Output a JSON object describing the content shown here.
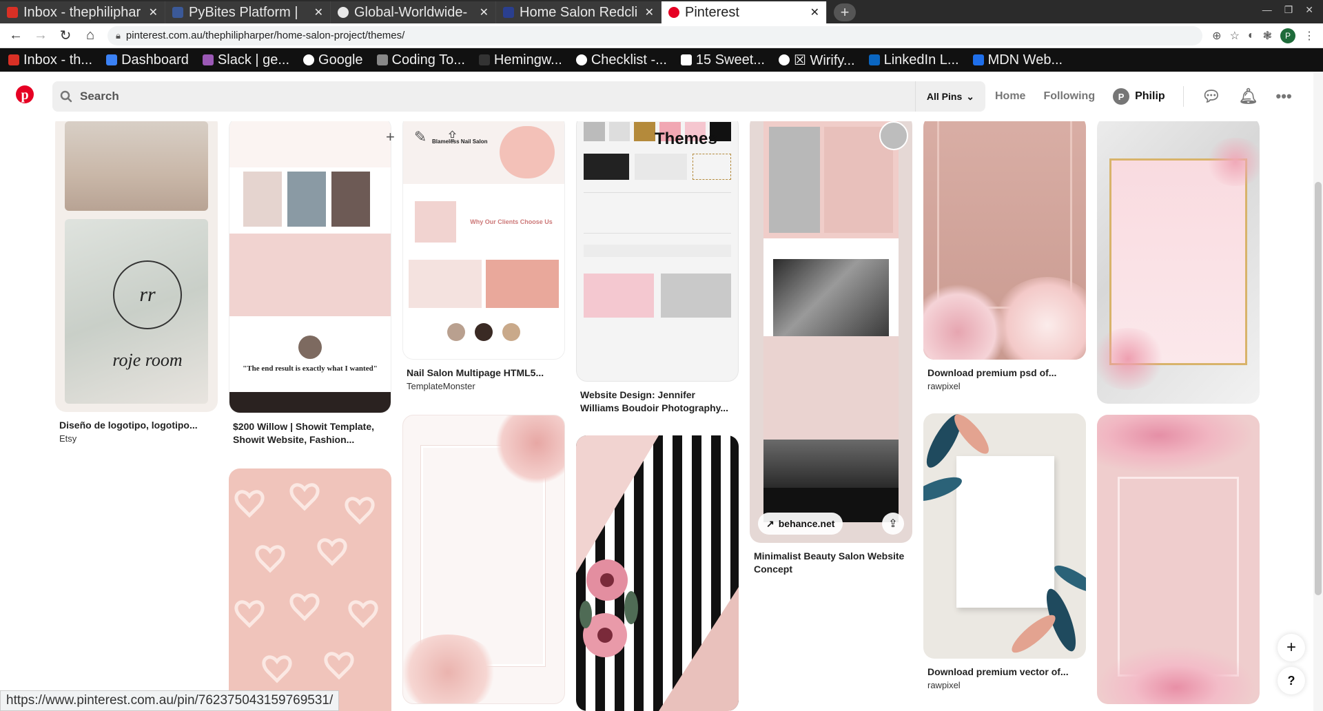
{
  "browser": {
    "tabs": [
      {
        "title": "Inbox - thephiliphar",
        "favicon_color": "#d93025",
        "active": false
      },
      {
        "title": "PyBites Platform | ",
        "favicon_color": "#3b5998",
        "active": false
      },
      {
        "title": "Global-Worldwide-",
        "favicon_color": "#e8e8e8",
        "active": false
      },
      {
        "title": "Home Salon Redcli",
        "favicon_color": "#2a3f8f",
        "active": false
      },
      {
        "title": "Pinterest",
        "favicon_color": "#e60023",
        "active": true
      }
    ],
    "new_tab": "+",
    "url": "pinterest.com.au/thephilipharper/home-salon-project/themes/",
    "profile_initial": "P",
    "bookmarks": [
      {
        "label": "Inbox - th...",
        "color": "#d93025"
      },
      {
        "label": "Dashboard",
        "color": "#3b82f6"
      },
      {
        "label": "Slack | ge...",
        "color": "#4a154b"
      },
      {
        "label": "Google",
        "color": "#ffffff"
      },
      {
        "label": "Coding To...",
        "color": "#888888"
      },
      {
        "label": "Hemingw...",
        "color": "#222222"
      },
      {
        "label": "Checklist -...",
        "color": "#ffffff"
      },
      {
        "label": "15 Sweet...",
        "color": "#ffffff"
      },
      {
        "label": "☒ Wirify...",
        "color": "#ffffff"
      },
      {
        "label": "LinkedIn L...",
        "color": "#0a66c2"
      },
      {
        "label": "MDN Web...",
        "color": "#1f6feb"
      }
    ]
  },
  "header": {
    "search_placeholder": "Search",
    "filter": "All Pins",
    "nav": {
      "home": "Home",
      "following": "Following",
      "user": "Philip",
      "user_initial": "P"
    }
  },
  "board": {
    "title": "Themes"
  },
  "pins": [
    {
      "title": "Diseño de logotipo, logotipo...",
      "source": "Etsy"
    },
    {
      "title": "$200 Willow | Showit Template, Showit Website, Fashion...",
      "source": ""
    },
    {
      "title": "Nail Salon Multipage HTML5...",
      "source": "TemplateMonster"
    },
    {
      "title": "Website Design: Jennifer Williams Boudoir Photography...",
      "source": ""
    },
    {
      "title": "Minimalist Beauty Salon Website Concept",
      "source": "",
      "chip": "behance.net"
    },
    {
      "title": "Download premium psd of...",
      "source": "rawpixel"
    },
    {
      "title": "Download premium vector of...",
      "source": "rawpixel"
    }
  ],
  "status_url": "https://www.pinterest.com.au/pin/762375043159769531/",
  "fabs": {
    "add": "+",
    "help": "?"
  },
  "colors": {
    "pinterest_red": "#e60023",
    "blush": "#f1d3d0",
    "dusty_rose": "#e2b8b2"
  }
}
